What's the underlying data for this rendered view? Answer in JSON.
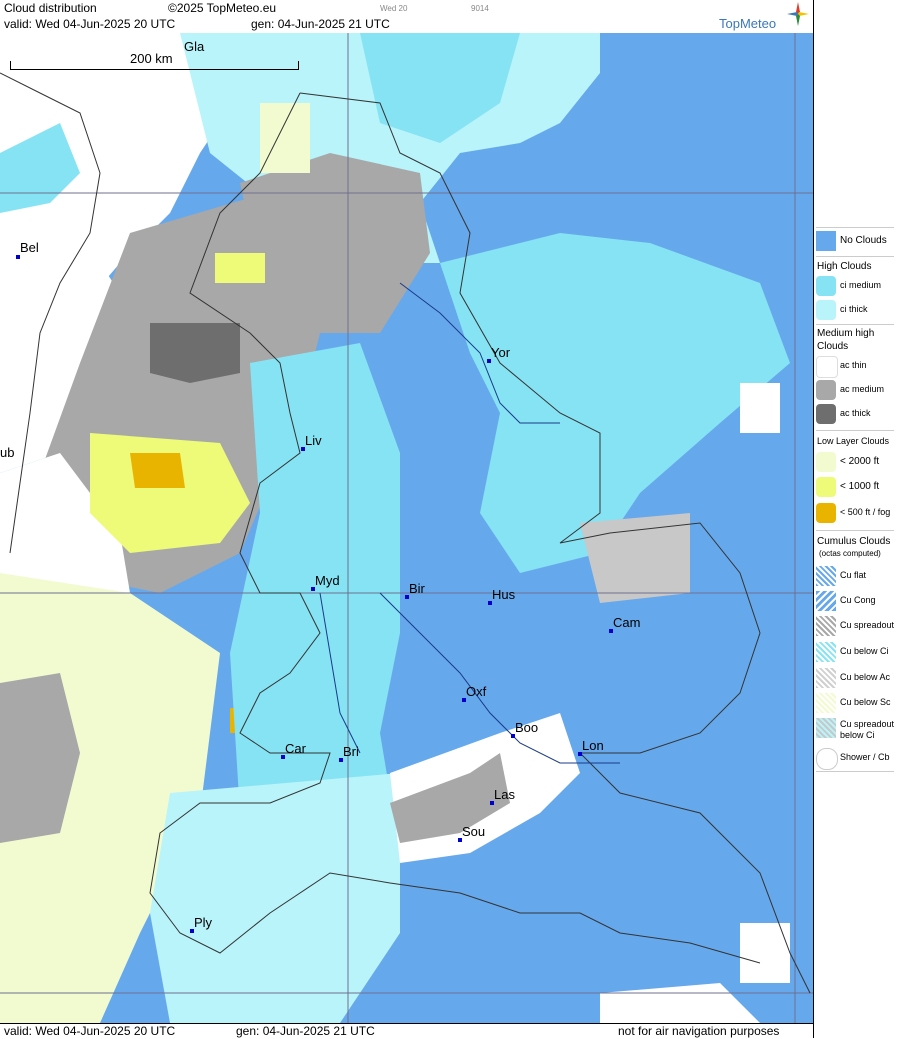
{
  "header": {
    "title": "Cloud distribution",
    "copyright": "©2025 TopMeteo.eu",
    "tiny1": "Wed 20",
    "tiny2": "9014",
    "valid": "valid:  Wed  04-Jun-2025  20 UTC",
    "gen": "gen: 04-Jun-2025 21 UTC",
    "logo": "TopMeteo"
  },
  "footer": {
    "valid": "valid:  Wed  04-Jun-2025  20 UTC",
    "gen": "gen: 04-Jun-2025 21 UTC",
    "disclaimer": "not for air navigation purposes"
  },
  "scale": {
    "label": "200 km"
  },
  "colors": {
    "no_clouds": "#66a8ec",
    "ci_medium": "#86e3f4",
    "ci_thick": "#b8f4fa",
    "ac_thin": "#ffffff",
    "ac_medium": "#a8a8a8",
    "ac_thick": "#6e6e6e",
    "low_2000": "#f2fbd0",
    "low_1000": "#eefb78",
    "low_500": "#e8b400"
  },
  "cities": [
    {
      "id": "gla",
      "name": "Gla"
    },
    {
      "id": "bel",
      "name": "Bel"
    },
    {
      "id": "dub",
      "name": "ub"
    },
    {
      "id": "yor",
      "name": "Yor"
    },
    {
      "id": "liv",
      "name": "Liv"
    },
    {
      "id": "myd",
      "name": "Myd"
    },
    {
      "id": "bir",
      "name": "Bir"
    },
    {
      "id": "hus",
      "name": "Hus"
    },
    {
      "id": "cam",
      "name": "Cam"
    },
    {
      "id": "oxf",
      "name": "Oxf"
    },
    {
      "id": "boo",
      "name": "Boo"
    },
    {
      "id": "lon",
      "name": "Lon"
    },
    {
      "id": "car",
      "name": "Car"
    },
    {
      "id": "bri",
      "name": "Bri"
    },
    {
      "id": "las",
      "name": "Las"
    },
    {
      "id": "sou",
      "name": "Sou"
    },
    {
      "id": "ply",
      "name": "Ply"
    }
  ],
  "legend": {
    "no_clouds": "No Clouds",
    "high_title": "High Clouds",
    "ci_medium": "ci medium",
    "ci_thick": "ci thick",
    "medium_title_1": "Medium high",
    "medium_title_2": "Clouds",
    "ac_thin": "ac thin",
    "ac_medium": "ac medium",
    "ac_thick": "ac thick",
    "low_title": "Low Layer Clouds",
    "low_2000": "< 2000 ft",
    "low_1000": "< 1000 ft",
    "low_500": "< 500 ft / fog",
    "cu_title": "Cumulus Clouds",
    "cu_sub": "(octas computed)",
    "cu_flat": "Cu flat",
    "cu_cong": "Cu Cong",
    "cu_spread": "Cu spreadout",
    "cu_below_ci": "Cu below Ci",
    "cu_below_ac": "Cu below Ac",
    "cu_below_sc": "Cu below Sc",
    "cu_spread_ci_1": "Cu spreadout",
    "cu_spread_ci_2": "below Ci",
    "shower": "Shower / Cb"
  }
}
